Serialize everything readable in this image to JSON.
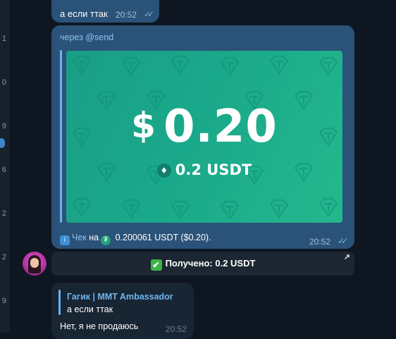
{
  "left_strip": {
    "numbers": [
      "1",
      "0",
      "9",
      "6",
      "2",
      "2",
      "9"
    ]
  },
  "messages": [
    {
      "text": "а если ттак",
      "time": "20:52",
      "read_ticks": "✓✓"
    },
    {
      "via_prefix": "через",
      "via_bot": "@send",
      "card": {
        "currency_symbol": "$",
        "amount": "0.20",
        "usdt_amount": "0.2 USDT",
        "token_icon": "tether-icon",
        "background_colors": [
          "#1a9e87",
          "#24b88d"
        ]
      },
      "check_icon": "info-emoji-icon",
      "check_label": "Чек",
      "check_on": "на",
      "token_glyph": "₮",
      "check_amount": "0.200061 USDT ($0.20).",
      "time": "20:52",
      "read_ticks": "✓✓"
    }
  ],
  "inline_button": {
    "emoji": "✔",
    "label": "Получено: 0.2 USDT",
    "corner_arrow": "↗"
  },
  "reply_message": {
    "quote_author": "Гагик | MMT Ambassador",
    "quote_text": "а если ттак",
    "text": "Нет, я не продаюсь",
    "time": "20:52"
  },
  "colors": {
    "background": "#0e1621",
    "outgoing_bubble": "#2b5278",
    "incoming_bubble": "#182533",
    "link": "#8cc2f0",
    "tick_blue": "#6fb6ee"
  }
}
